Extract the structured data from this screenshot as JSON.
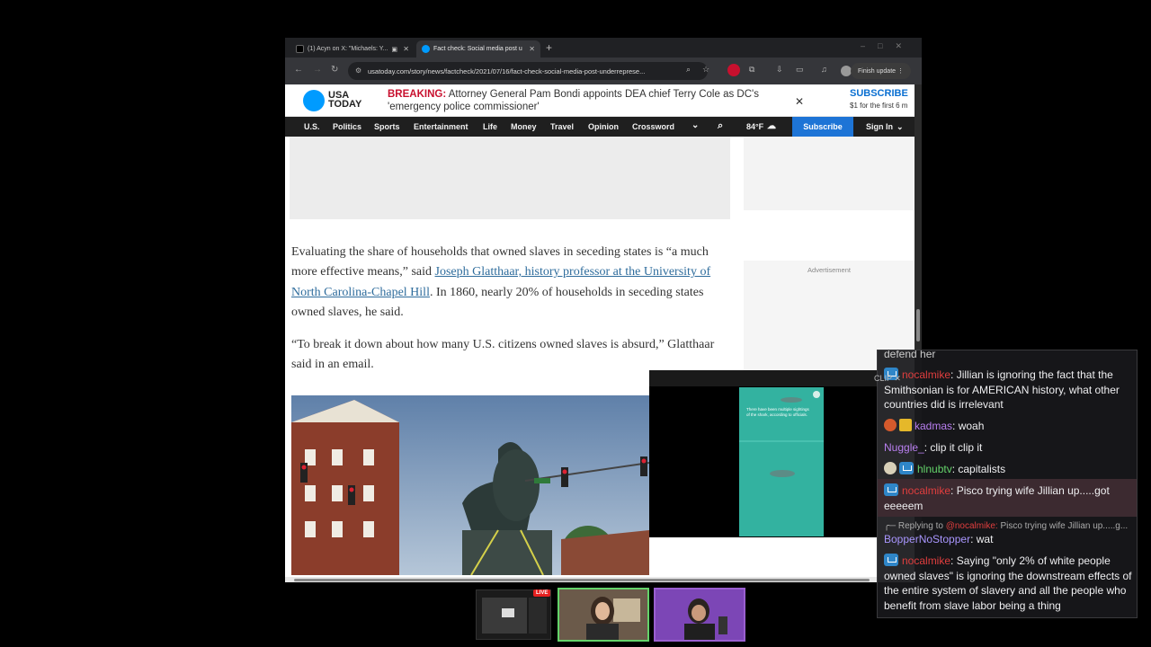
{
  "browser": {
    "tabs": [
      {
        "title": "(1) Acyn on X: \"Michaels: Y...",
        "active": false
      },
      {
        "title": "Fact check: Social media post u",
        "active": true
      }
    ],
    "new_tab": "+",
    "url": "usatoday.com/story/news/factcheck/2021/07/16/fact-check-social-media-post-underreprese...",
    "finish_update": "Finish update"
  },
  "site": {
    "logo": "USA TODAY",
    "breaking_label": "BREAKING:",
    "breaking_text": "Attorney General Pam Bondi appoints DEA chief Terry Cole as DC's 'emergency police commissioner'",
    "subscribe_title": "SUBSCRIBE",
    "subscribe_sub": "$1 for the first 6 m",
    "nav": [
      "U.S.",
      "Politics",
      "Sports",
      "Entertainment",
      "Life",
      "Money",
      "Travel",
      "Opinion",
      "Crossword"
    ],
    "weather": "84°F",
    "nav_subscribe": "Subscribe",
    "sign_in": "Sign In",
    "advertisement": "Advertisement"
  },
  "article": {
    "p1_before": "Evaluating the share of households that owned slaves in seceding states is “a much more effective means,” said ",
    "p1_link": "Joseph Glatthaar, history professor at the University of North Carolina-Chapel Hill",
    "p1_after": ". In 1860, nearly 20% of households in seceding states owned slaves, he said.",
    "p2": "“To break it down about how many U.S. citizens owned slaves is absurd,” Glatthaar said in an email."
  },
  "overlay": {
    "caption": "There have been multiple sightings of the shark, according to officials."
  },
  "chat": {
    "top_fragment": "defend her",
    "messages": [
      {
        "user": "nocalmike",
        "text": "Jillian is ignoring the fact that the Smithsonian is for AMERICAN history, what other countries did is irrelevant"
      },
      {
        "user": "kadmas",
        "text": "woah"
      },
      {
        "user": "Nuggle_",
        "text": "clip it clip it"
      },
      {
        "user": "hlnubtv",
        "text": "capitalists"
      },
      {
        "user": "nocalmike",
        "text": "Pisco trying wife Jillian up.....got eeeeem"
      },
      {
        "user": "BopperNoStopper",
        "text": "wat",
        "reply_prefix": "Replying to",
        "reply_user": "@nocalmike:",
        "reply_text": "Pisco trying wife Jillian up.....g..."
      },
      {
        "user": "nocalmike",
        "text": "Saying \"only 2% of white people owned slaves\" is ignoring the downstream effects of the entire system of slavery and all the people who benefit from slave labor being a thing"
      }
    ],
    "clip_label": "CLIP"
  },
  "stream": {
    "live": "LIVE"
  },
  "colors": {
    "usa_blue": "#009bff",
    "breaking_red": "#c8102e",
    "link_blue": "#2e6c9c",
    "subscribe_blue": "#1d74d6"
  }
}
